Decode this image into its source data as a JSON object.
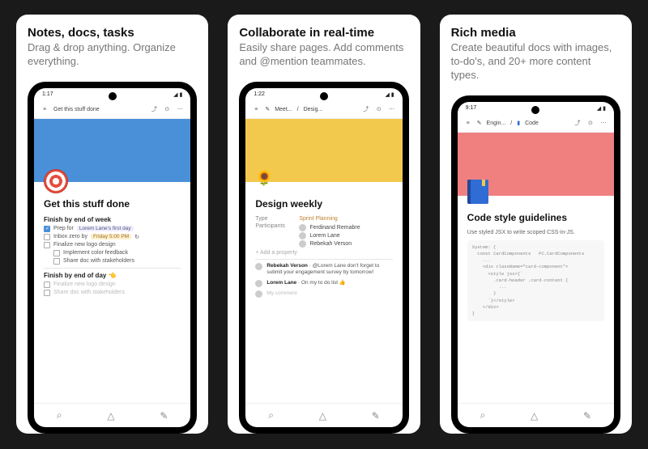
{
  "panels": [
    {
      "title": "Notes, docs, tasks",
      "subtitle": "Drag & drop anything. Organize everything.",
      "statusTime": "1:17",
      "toolbarTitle": "Get this stuff done",
      "heroColor": "blue",
      "pageTitle": "Get this stuff done",
      "section1": "Finish by end of week",
      "todos": [
        {
          "checked": true,
          "text": "Prep for",
          "pill": "Lorem Lane's first day"
        },
        {
          "checked": false,
          "text": "Inbox zero by",
          "pill": "Friday 5:00 PM"
        },
        {
          "checked": false,
          "text": "Finalize new logo design"
        },
        {
          "checked": false,
          "text": "Implement color feedback",
          "nested": true
        },
        {
          "checked": false,
          "text": "Share doc with stakeholders",
          "nested": true
        }
      ],
      "section2": "Finish by end of day 👈",
      "fadedTodos": [
        {
          "text": "Finalize new logo design"
        },
        {
          "text": "Share doc with stakeholders"
        }
      ]
    },
    {
      "title": "Collaborate in real-time",
      "subtitle": "Easily share pages. Add comments and @mention teammates.",
      "statusTime": "1:22",
      "toolbarPills": [
        "Meet...",
        "Desig..."
      ],
      "heroColor": "yellow",
      "pageTitle": "Design weekly",
      "typeLabel": "Type",
      "typeValue": "Sprint Planning",
      "participantsLabel": "Participants",
      "participants": [
        "Ferdinand Remabre",
        "Lorem Lane",
        "Rebekah Verson"
      ],
      "addProperty": "+ Add a property",
      "comments": [
        {
          "name": "Rebekah Verson",
          "text": "@Lorem Lane don't forget to submit your engagement survey by tomorrow!"
        },
        {
          "name": "Lorem Lane",
          "text": "On my to do list 👍"
        }
      ],
      "myComment": "My comment"
    },
    {
      "title": "Rich media",
      "subtitle": "Create beautiful docs with images, to-do's, and 20+ more content types.",
      "statusTime": "9:17",
      "toolbarPills": [
        "Engin...",
        "Code"
      ],
      "heroColor": "red",
      "pageTitle": "Code style guidelines",
      "codeDesc": "Use styled JSX to write scoped CSS-in-JS.",
      "codeBlock": "System: {\n  const CardComponents   PC.CardComponents\n    ...\n    <div className=\"card-component\">\n      <style jsx>{`\n        .card-header .card-content {\n          ...\n        }\n      `}</style>\n    </div>\n}"
    }
  ],
  "icons": {
    "menu": "≡",
    "share": "⤴",
    "more": "⋯",
    "comment": "⊙",
    "search": "⌕",
    "bell": "△",
    "compose": "✎",
    "pencil": "✎",
    "book": "▮"
  }
}
